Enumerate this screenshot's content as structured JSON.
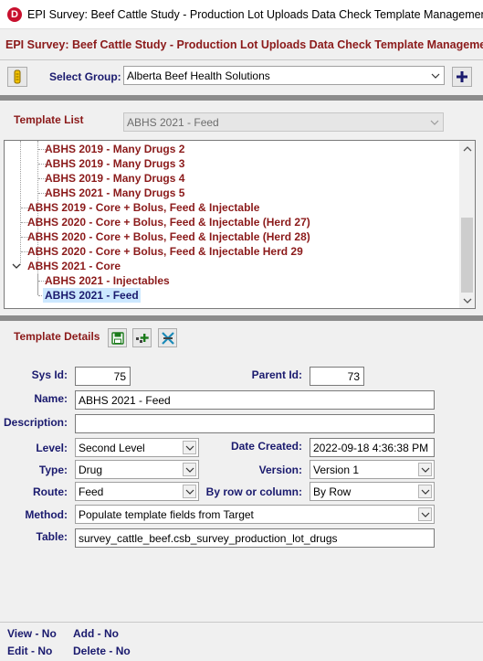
{
  "window": {
    "title": "EPI Survey: Beef Cattle Study - Production Lot Uploads Data Check Template Management",
    "app_icon_letter": "D"
  },
  "header": {
    "title": "EPI Survey: Beef Cattle Study - Production Lot Uploads Data Check Template Management"
  },
  "group": {
    "label": "Select Group:",
    "selected": "Alberta Beef Health Solutions"
  },
  "template_list": {
    "label": "Template List",
    "filter_selected": "ABHS 2021 - Feed",
    "items": [
      {
        "label": "ABHS 2019 - Many Drugs 2",
        "level": 2
      },
      {
        "label": "ABHS 2019 - Many Drugs 3",
        "level": 2
      },
      {
        "label": "ABHS 2019 - Many Drugs 4",
        "level": 2
      },
      {
        "label": "ABHS 2021 - Many Drugs 5",
        "level": 2
      },
      {
        "label": "ABHS 2019 - Core + Bolus, Feed & Injectable",
        "level": 1
      },
      {
        "label": "ABHS 2020 - Core + Bolus, Feed & Injectable (Herd 27)",
        "level": 1
      },
      {
        "label": "ABHS 2020 - Core + Bolus, Feed & Injectable (Herd 28)",
        "level": 1
      },
      {
        "label": "ABHS 2020 - Core + Bolus, Feed & Injectable Herd 29",
        "level": 1
      },
      {
        "label": "ABHS 2021 - Core",
        "level": 1,
        "expanded": true
      },
      {
        "label": "ABHS 2021 - Injectables",
        "level": 2
      },
      {
        "label": "ABHS 2021 - Feed",
        "level": 2,
        "selected": true
      }
    ]
  },
  "details": {
    "label": "Template Details",
    "sys_id_label": "Sys Id:",
    "sys_id": "75",
    "parent_id_label": "Parent Id:",
    "parent_id": "73",
    "name_label": "Name:",
    "name": "ABHS 2021 - Feed",
    "description_label": "Description:",
    "description": "",
    "level_label": "Level:",
    "level": "Second Level",
    "date_created_label": "Date Created:",
    "date_created": "2022-09-18 4:36:38 PM",
    "type_label": "Type:",
    "type": "Drug",
    "version_label": "Version:",
    "version": "Version 1",
    "route_label": "Route:",
    "route": "Feed",
    "by_row_label": "By row or column:",
    "by_row": "By Row",
    "method_label": "Method:",
    "method": "Populate template fields from Target",
    "table_label": "Table:",
    "table": "survey_cattle_beef.csb_survey_production_lot_drugs"
  },
  "permissions": {
    "view_label": "View - ",
    "view": "No",
    "add_label": "Add - ",
    "add": "No",
    "edit_label": "Edit - ",
    "edit": "No",
    "delete_label": "Delete - ",
    "delete": "No"
  },
  "colors": {
    "accent_red": "#8b1a1a",
    "label_navy": "#1a1a6e",
    "selection": "#cce8ff"
  },
  "icons": [
    "key-icon",
    "add-group-icon",
    "save-icon",
    "add-child-icon",
    "delete-icon",
    "chevron-down-icon",
    "chevron-up-icon"
  ]
}
